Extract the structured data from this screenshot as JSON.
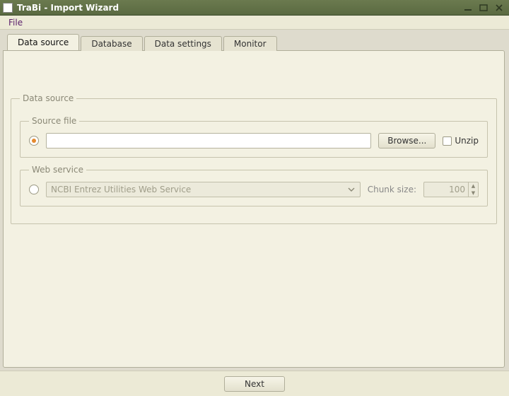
{
  "window": {
    "title": "TraBi - Import Wizard"
  },
  "menu": {
    "file": "File"
  },
  "tabs": [
    {
      "label": "Data source",
      "active": true
    },
    {
      "label": "Database",
      "active": false
    },
    {
      "label": "Data settings",
      "active": false
    },
    {
      "label": "Monitor",
      "active": false
    }
  ],
  "groups": {
    "data_source": {
      "legend": "Data source",
      "source_file": {
        "legend": "Source file",
        "selected": true,
        "path": "",
        "browse_label": "Browse...",
        "unzip_label": "Unzip",
        "unzip_checked": false
      },
      "web_service": {
        "legend": "Web service",
        "selected": false,
        "service_name": "NCBI Entrez Utilities Web Service",
        "chunk_label": "Chunk size:",
        "chunk_value": "100"
      }
    }
  },
  "footer": {
    "next_label": "Next"
  }
}
